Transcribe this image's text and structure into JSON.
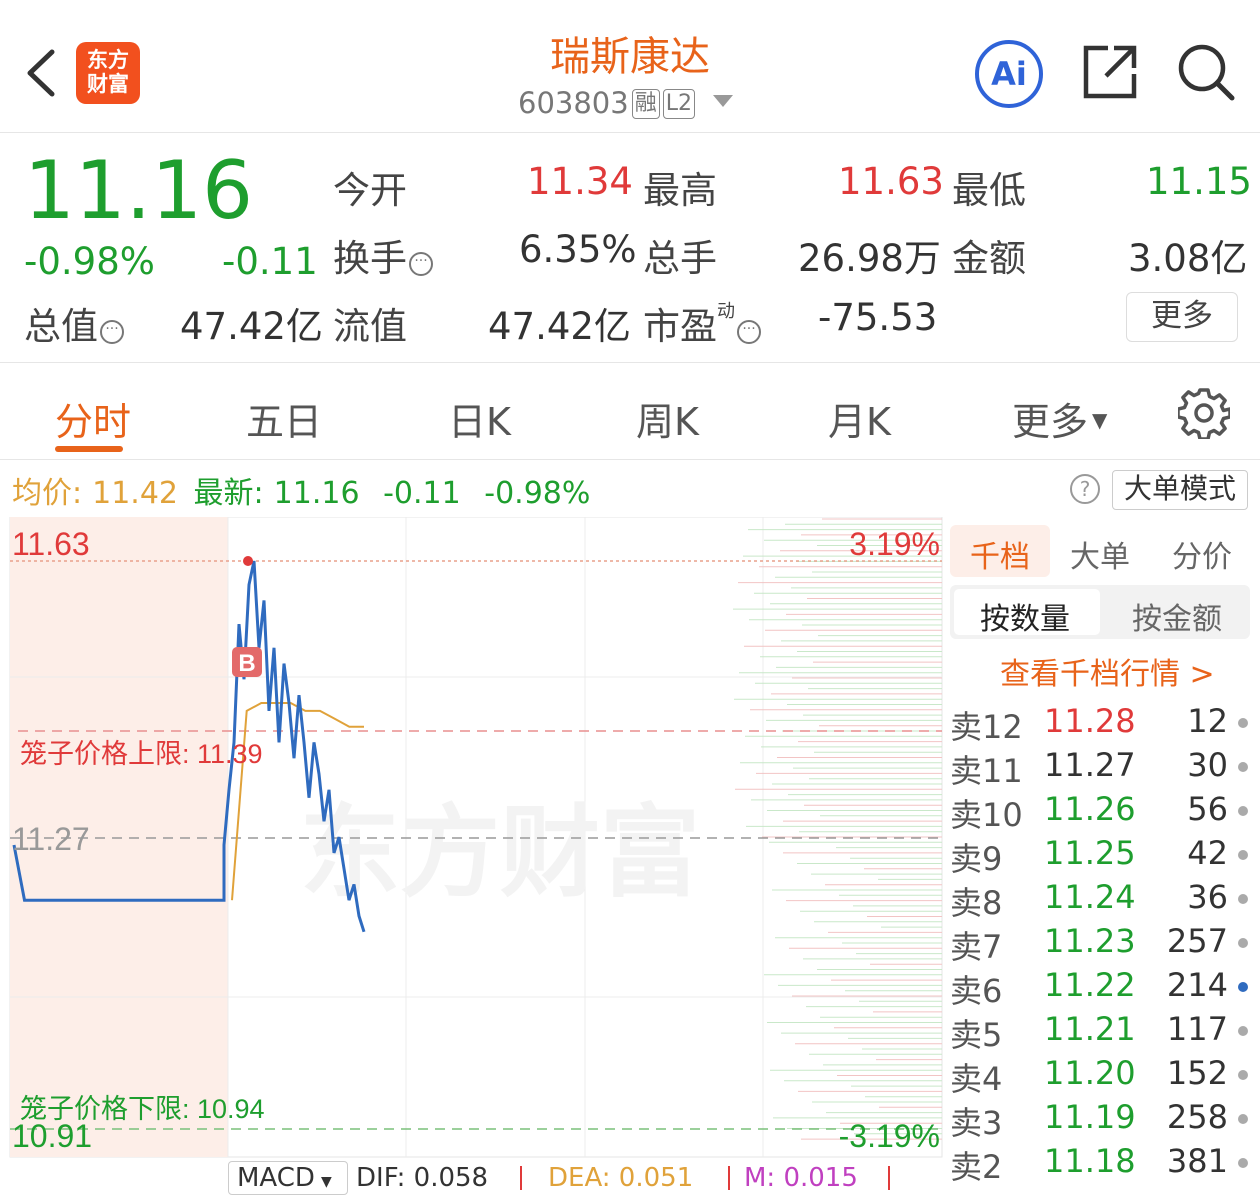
{
  "header": {
    "logo_text_line1": "东方",
    "logo_text_line2": "财富",
    "title": "瑞斯康达",
    "code": "603803",
    "tag_rong": "融",
    "tag_l2": "L2",
    "ai_label": "Ai"
  },
  "quote": {
    "price": "11.16",
    "change_pct": "-0.98%",
    "change": "-0.11",
    "open_label": "今开",
    "open": "11.34",
    "high_label": "最高",
    "high": "11.63",
    "low_label": "最低",
    "low": "11.15",
    "turnover_label": "换手",
    "turnover": "6.35%",
    "volume_label": "总手",
    "volume": "26.98万",
    "amount_label": "金额",
    "amount": "3.08亿",
    "total_mv_label": "总值",
    "total_mv": "47.42亿",
    "float_mv_label": "流值",
    "float_mv": "47.42亿",
    "pe_label": "市盈",
    "pe_sup": "动",
    "pe": "-75.53",
    "more_label": "更多",
    "dots": "···"
  },
  "tabs": [
    "分时",
    "五日",
    "日K",
    "周K",
    "月K",
    "更多"
  ],
  "info": {
    "avg_label": "均价:",
    "avg": "11.42",
    "latest_label": "最新:",
    "latest": "11.16",
    "chg": "-0.11",
    "chg_pct": "-0.98%",
    "help": "?",
    "big_mode": "大单模式"
  },
  "chart_labels": {
    "top_price": "11.63",
    "mid_price": "11.27",
    "bottom_price": "10.91",
    "top_pct": "3.19%",
    "bottom_pct": "-3.19%",
    "upper_limit": "笼子价格上限: 11.39",
    "lower_limit": "笼子价格下限: 10.94",
    "watermark": "东方财富",
    "b_marker": "B"
  },
  "chart_data": {
    "type": "line",
    "ylim": [
      10.91,
      11.63
    ],
    "series": [
      {
        "values": [
          11.27,
          11.2,
          11.2,
          11.2,
          11.2,
          11.2,
          11.2,
          11.2,
          11.2,
          11.2,
          11.2,
          11.2,
          11.2,
          11.2,
          11.2,
          11.2,
          11.2,
          11.2,
          11.2,
          11.2,
          11.2,
          11.27,
          11.34,
          11.4,
          11.55,
          11.48,
          11.6,
          11.63,
          11.52,
          11.58,
          11.44,
          11.52,
          11.4,
          11.5,
          11.45,
          11.38,
          11.46,
          11.4,
          11.33,
          11.4,
          11.36,
          11.3,
          11.34,
          11.26,
          11.28,
          11.24,
          11.2,
          11.22,
          11.18,
          11.16
        ]
      },
      {
        "values": [
          11.42,
          11.44,
          11.45,
          11.45,
          11.45,
          11.44,
          11.44,
          11.43,
          11.42,
          11.42
        ]
      }
    ],
    "avg_start_index": 40,
    "upper_limit": 11.39,
    "lower_limit": 10.94,
    "prev_close": 11.27
  },
  "macd": {
    "label": "MACD",
    "dif": "DIF: 0.058",
    "dea": "DEA: 0.051",
    "m": "M: 0.015"
  },
  "orderbook": {
    "tabs": [
      "千档",
      "大单",
      "分价"
    ],
    "mode_tabs": [
      "按数量",
      "按金额"
    ],
    "link": "查看千档行情 >",
    "rows": [
      {
        "label": "卖12",
        "price": "11.28",
        "vol": "12",
        "pcolor": "red"
      },
      {
        "label": "卖11",
        "price": "11.27",
        "vol": "30",
        "pcolor": "gray"
      },
      {
        "label": "卖10",
        "price": "11.26",
        "vol": "56",
        "pcolor": "green"
      },
      {
        "label": "卖9",
        "price": "11.25",
        "vol": "42",
        "pcolor": "green"
      },
      {
        "label": "卖8",
        "price": "11.24",
        "vol": "36",
        "pcolor": "green"
      },
      {
        "label": "卖7",
        "price": "11.23",
        "vol": "257",
        "pcolor": "green"
      },
      {
        "label": "卖6",
        "price": "11.22",
        "vol": "214",
        "pcolor": "green"
      },
      {
        "label": "卖5",
        "price": "11.21",
        "vol": "117",
        "pcolor": "green"
      },
      {
        "label": "卖4",
        "price": "11.20",
        "vol": "152",
        "pcolor": "green"
      },
      {
        "label": "卖3",
        "price": "11.19",
        "vol": "258",
        "pcolor": "green"
      },
      {
        "label": "卖2",
        "price": "11.18",
        "vol": "381",
        "pcolor": "green"
      }
    ]
  },
  "colors": {
    "accent": "#e8631a",
    "up": "#e03a3a",
    "down": "#1e9e2e",
    "line": "#2f6bbf",
    "avg": "#e0a23a"
  }
}
